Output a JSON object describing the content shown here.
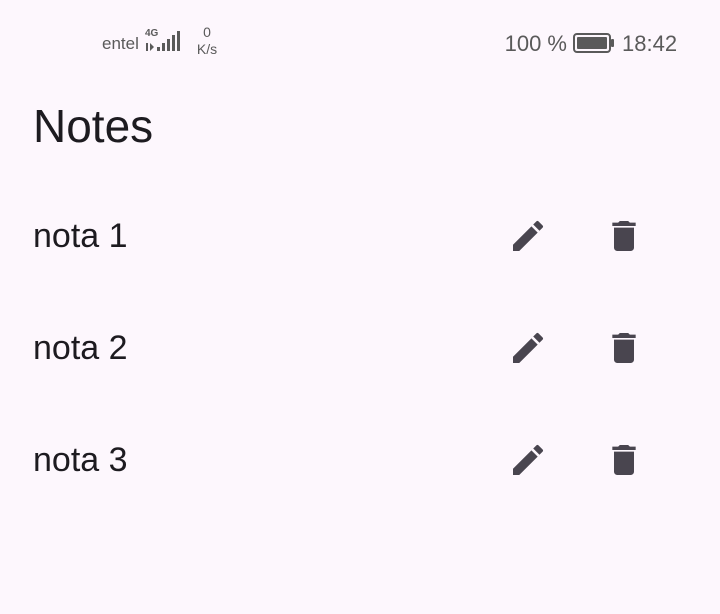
{
  "status_bar": {
    "carrier": "entel",
    "network_type": "4G",
    "speed_value": "0",
    "speed_unit": "K/s",
    "battery_percent": "100 %",
    "time": "18:42",
    "icons": [
      "signal-icon",
      "battery-icon"
    ]
  },
  "app_bar": {
    "title": "Notes"
  },
  "notes": [
    {
      "title": "nota 1"
    },
    {
      "title": "nota 2"
    },
    {
      "title": "nota 3"
    }
  ],
  "colors": {
    "background": "#FDF7FD",
    "text": "#1D1B20",
    "icon": "#49454F",
    "status_text": "#5A5A5A"
  },
  "row_icons": [
    "edit-icon",
    "delete-icon"
  ]
}
